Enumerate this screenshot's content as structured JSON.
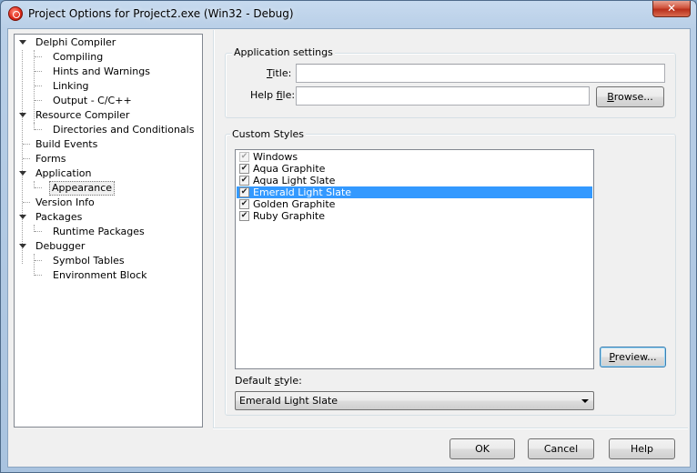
{
  "window": {
    "title": "Project Options for Project2.exe  (Win32 - Debug)",
    "close_glyph": "✕"
  },
  "tree": {
    "items": [
      {
        "label": "Delphi Compiler",
        "expandable": true
      },
      {
        "label": "Compiling"
      },
      {
        "label": "Hints and Warnings"
      },
      {
        "label": "Linking"
      },
      {
        "label": "Output - C/C++"
      },
      {
        "label": "Resource Compiler",
        "expandable": true
      },
      {
        "label": "Directories and Conditionals"
      },
      {
        "label": "Build Events"
      },
      {
        "label": "Forms"
      },
      {
        "label": "Application",
        "expandable": true
      },
      {
        "label": "Appearance",
        "selected": true
      },
      {
        "label": "Version Info"
      },
      {
        "label": "Packages",
        "expandable": true
      },
      {
        "label": "Runtime Packages"
      },
      {
        "label": "Debugger",
        "expandable": true
      },
      {
        "label": "Symbol Tables"
      },
      {
        "label": "Environment Block"
      }
    ]
  },
  "app_settings": {
    "caption": "Application settings",
    "title_label_u": "T",
    "title_label_rest": "itle:",
    "title_value": "",
    "helpfile_label_pre": "Help ",
    "helpfile_label_u": "f",
    "helpfile_label_rest": "ile:",
    "helpfile_value": "",
    "browse_u": "B",
    "browse_rest": "rowse..."
  },
  "custom_styles": {
    "caption": "Custom Styles",
    "items": [
      {
        "label": "Windows",
        "checked": true,
        "disabled": true
      },
      {
        "label": "Aqua Graphite",
        "checked": true
      },
      {
        "label": "Aqua Light Slate",
        "checked": true
      },
      {
        "label": "Emerald Light Slate",
        "checked": true,
        "selected": true
      },
      {
        "label": "Golden Graphite",
        "checked": true
      },
      {
        "label": "Ruby Graphite",
        "checked": true
      }
    ],
    "check_glyph": "✔",
    "preview_u": "P",
    "preview_rest": "review...",
    "default_style_label_pre": "Default ",
    "default_style_label_u": "s",
    "default_style_label_rest": "tyle:",
    "default_style_value": "Emerald Light Slate"
  },
  "buttons": {
    "ok": "OK",
    "cancel": "Cancel",
    "help": "Help"
  },
  "colors": {
    "selection": "#3399ff",
    "dialog_bg": "#f0f0f0"
  }
}
